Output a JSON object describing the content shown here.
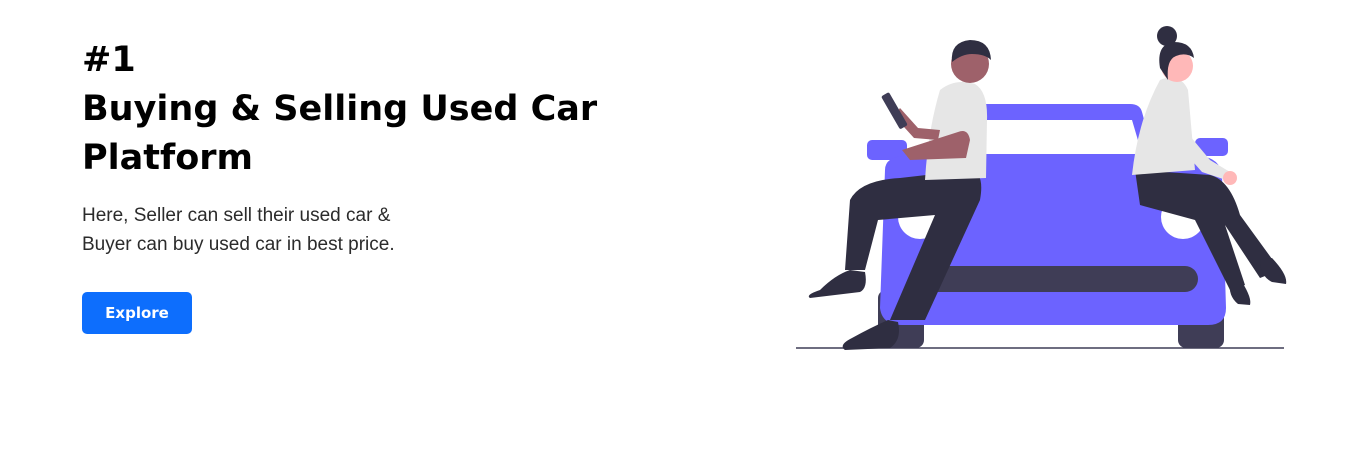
{
  "hero": {
    "title_line1": "#1",
    "title_line2": "Buying & Selling Used Car",
    "title_line3": "Platform",
    "description_line1": "Here, Seller can sell their used car &",
    "description_line2": "Buyer can buy used car in best price.",
    "explore_label": "Explore"
  },
  "colors": {
    "button": "#0d6efd",
    "car_body": "#6c63ff",
    "car_dark": "#3f3d56",
    "pants": "#2f2e41",
    "shirt": "#e6e6e6"
  },
  "illustration": {
    "icon": "people-sitting-on-car-illustration"
  }
}
